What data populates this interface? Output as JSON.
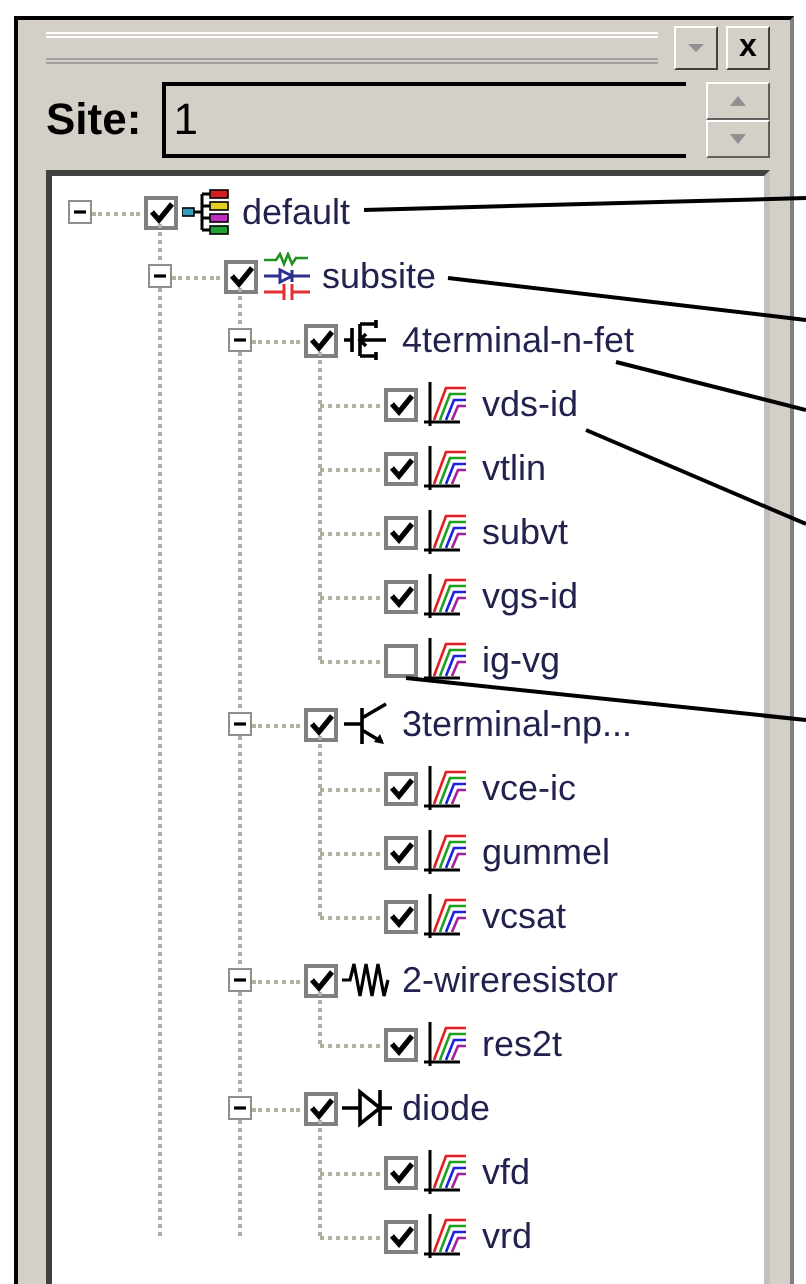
{
  "toolbar": {
    "close_label": "x"
  },
  "site": {
    "label": "Site:",
    "value": "1"
  },
  "tree": [
    {
      "label": "default",
      "kind": "site",
      "checked": true,
      "expanded": true,
      "children": [
        {
          "label": "subsite",
          "kind": "subsite",
          "checked": true,
          "expanded": true,
          "children": [
            {
              "label": "4terminal-n-fet",
              "kind": "fet",
              "checked": true,
              "expanded": true,
              "children": [
                {
                  "label": "vds-id",
                  "kind": "plot",
                  "checked": true
                },
                {
                  "label": "vtlin",
                  "kind": "plot",
                  "checked": true
                },
                {
                  "label": "subvt",
                  "kind": "plot",
                  "checked": true
                },
                {
                  "label": "vgs-id",
                  "kind": "plot",
                  "checked": true
                },
                {
                  "label": "ig-vg",
                  "kind": "plot",
                  "checked": false
                }
              ]
            },
            {
              "label": "3terminal-np...",
              "kind": "bjt",
              "checked": true,
              "expanded": true,
              "children": [
                {
                  "label": "vce-ic",
                  "kind": "plot",
                  "checked": true
                },
                {
                  "label": "gummel",
                  "kind": "plot",
                  "checked": true
                },
                {
                  "label": "vcsat",
                  "kind": "plot",
                  "checked": true
                }
              ]
            },
            {
              "label": "2-wireresistor",
              "kind": "resistor",
              "checked": true,
              "expanded": true,
              "children": [
                {
                  "label": "res2t",
                  "kind": "plot",
                  "checked": true
                }
              ]
            },
            {
              "label": "diode",
              "kind": "diode",
              "checked": true,
              "expanded": true,
              "children": [
                {
                  "label": "vfd",
                  "kind": "plot",
                  "checked": true
                },
                {
                  "label": "vrd",
                  "kind": "plot",
                  "checked": true
                }
              ]
            }
          ]
        }
      ]
    }
  ]
}
